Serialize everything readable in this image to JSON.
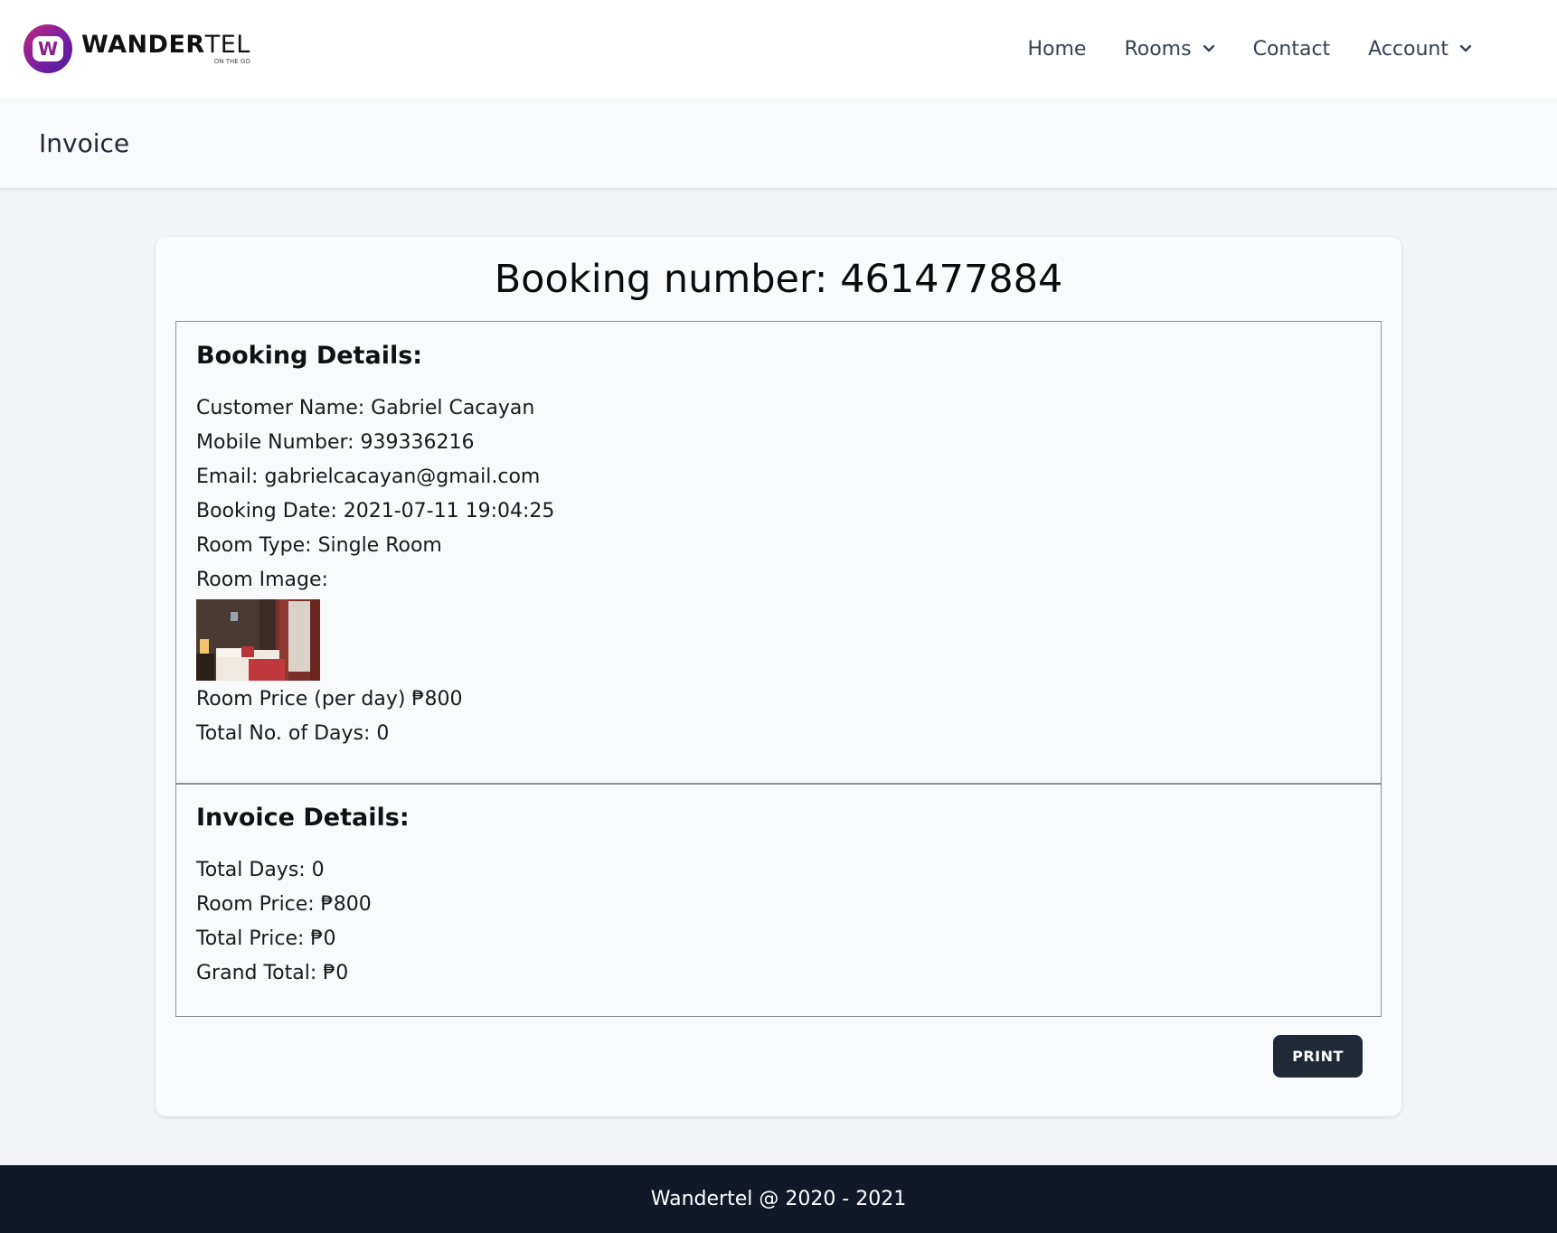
{
  "brand": {
    "name_bold": "WANDER",
    "name_light": "TEL",
    "tagline": "ON THE GO",
    "logo_letter": "W"
  },
  "nav": {
    "items": [
      {
        "label": "Home",
        "has_dropdown": false
      },
      {
        "label": "Rooms",
        "has_dropdown": true
      },
      {
        "label": "Contact",
        "has_dropdown": false
      },
      {
        "label": "Account",
        "has_dropdown": true
      }
    ]
  },
  "page": {
    "title": "Invoice"
  },
  "invoice": {
    "booking_number": "Booking number: 461477884",
    "booking_details": {
      "heading": "Booking Details:",
      "customer_name": "Customer Name: Gabriel Cacayan",
      "mobile_number": "Mobile Number: 939336216",
      "email": "Email: gabrielcacayan@gmail.com",
      "booking_date": "Booking Date: 2021-07-11 19:04:25",
      "room_type": "Room Type: Single Room",
      "room_image_label": "Room Image:",
      "room_price": "Room Price (per day) ₱800",
      "total_days": "Total No. of Days: 0"
    },
    "invoice_details": {
      "heading": "Invoice Details:",
      "total_days": "Total Days: 0",
      "room_price": "Room Price: ₱800",
      "total_price": "Total Price: ₱0",
      "grand_total": "Grand Total: ₱0"
    },
    "print_label": "PRINT"
  },
  "footer": {
    "text": "Wandertel @ 2020 - 2021"
  },
  "colors": {
    "accent": "#1f2937",
    "footer_bg": "#111827",
    "logo_gradient_start": "#c0267a",
    "logo_gradient_end": "#4c1d95"
  }
}
